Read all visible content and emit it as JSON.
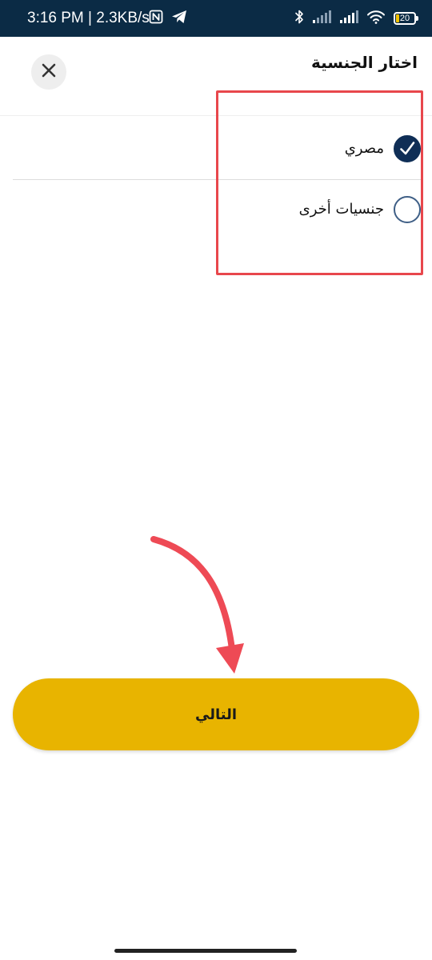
{
  "status_bar": {
    "time": "3:16 PM | 2.3KB/s",
    "battery_level": "20",
    "battery_color": "#f2c200",
    "icons_left": [
      "nfc-icon",
      "telegram-icon"
    ],
    "icons_right": [
      "bluetooth-icon",
      "signal-icon",
      "signal-icon",
      "wifi-icon",
      "battery-icon"
    ]
  },
  "header": {
    "title": "اختار الجنسية",
    "close_icon": "close-icon"
  },
  "options": [
    {
      "label": "مصري",
      "selected": true
    },
    {
      "label": "جنسيات أخرى",
      "selected": false
    }
  ],
  "next_button": {
    "label": "التالي",
    "color": "#e8b400"
  },
  "colors": {
    "status_bar": "#0b2b45",
    "radio_selected": "#0f2e56",
    "annotation": "#e8474c"
  }
}
